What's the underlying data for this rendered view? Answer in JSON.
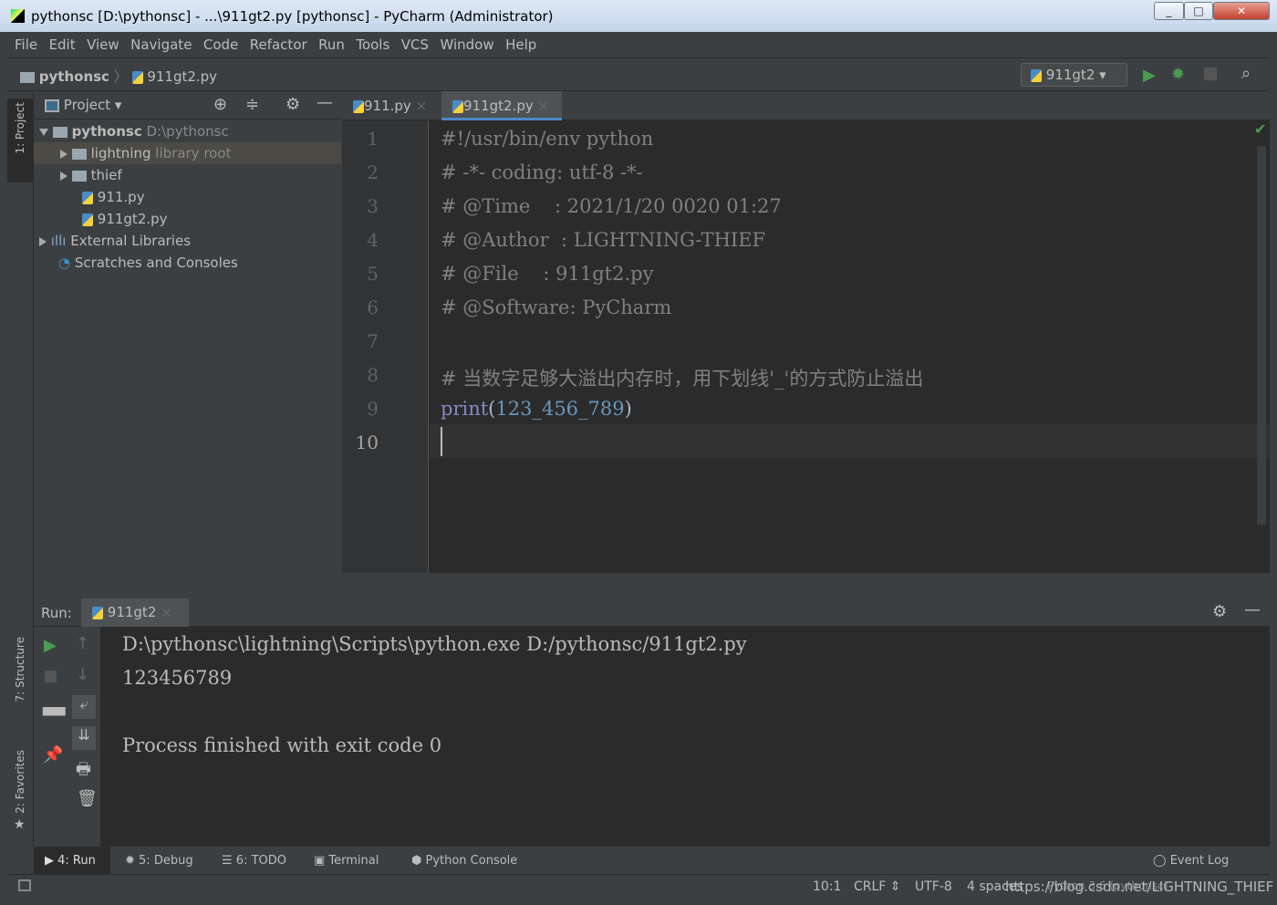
{
  "window": {
    "title": "pythonsc [D:\\pythonsc] - ...\\911gt2.py [pythonsc] - PyCharm (Administrator)"
  },
  "menu": [
    "File",
    "Edit",
    "View",
    "Navigate",
    "Code",
    "Refactor",
    "Run",
    "Tools",
    "VCS",
    "Window",
    "Help"
  ],
  "breadcrumb": {
    "project": "pythonsc",
    "file": "911gt2.py"
  },
  "run_config": "911gt2",
  "side_tabs": {
    "project": "1: Project",
    "structure": "7: Structure",
    "favorites": "2: Favorites"
  },
  "project_panel": {
    "title": "Project",
    "tree": [
      {
        "label": "pythonsc",
        "extra": "D:\\pythonsc"
      },
      {
        "label": "lightning",
        "extra": "library root"
      },
      {
        "label": "thief"
      },
      {
        "label": "911.py"
      },
      {
        "label": "911gt2.py"
      },
      {
        "label": "External Libraries"
      },
      {
        "label": "Scratches and Consoles"
      }
    ]
  },
  "editor": {
    "tabs": [
      {
        "label": "911.py"
      },
      {
        "label": "911gt2.py",
        "active": true
      }
    ],
    "lines": [
      "1",
      "2",
      "3",
      "4",
      "5",
      "6",
      "7",
      "8",
      "9",
      "10"
    ],
    "code": {
      "l1": "#!/usr/bin/env python",
      "l2": "# -*- coding: utf-8 -*-",
      "l3": "# @Time    : 2021/1/20 0020 01:27",
      "l4": "# @Author  : LIGHTNING-THIEF",
      "l5": "# @File    : 911gt2.py",
      "l6": "# @Software: PyCharm",
      "l8": "# 当数字足够大溢出内存时，用下划线'_'的方式防止溢出",
      "l9_fn": "print",
      "l9_open": "(",
      "l9_num": "123_456_789",
      "l9_close": ")"
    }
  },
  "run": {
    "label": "Run:",
    "tab": "911gt2",
    "output": [
      "D:\\pythonsc\\lightning\\Scripts\\python.exe D:/pythonsc/911gt2.py",
      "123456789",
      "",
      "Process finished with exit code 0"
    ]
  },
  "bottom_tabs": [
    "4: Run",
    "5: Debug",
    "6: TODO",
    "Terminal",
    "Python Console"
  ],
  "event_log": "Event Log",
  "status": {
    "position": "10:1",
    "line_sep": "CRLF",
    "encoding": "UTF-8",
    "indent": "4 spaces",
    "interpreter": "Python 3.6 (pythonsc)"
  },
  "watermark": "https://blog.csdn.net/LIGHTNING_THIEF",
  "colors": {
    "keyword": "#8888c6",
    "number": "#6897bb",
    "comment": "#808080",
    "run_green": "#499c54"
  }
}
